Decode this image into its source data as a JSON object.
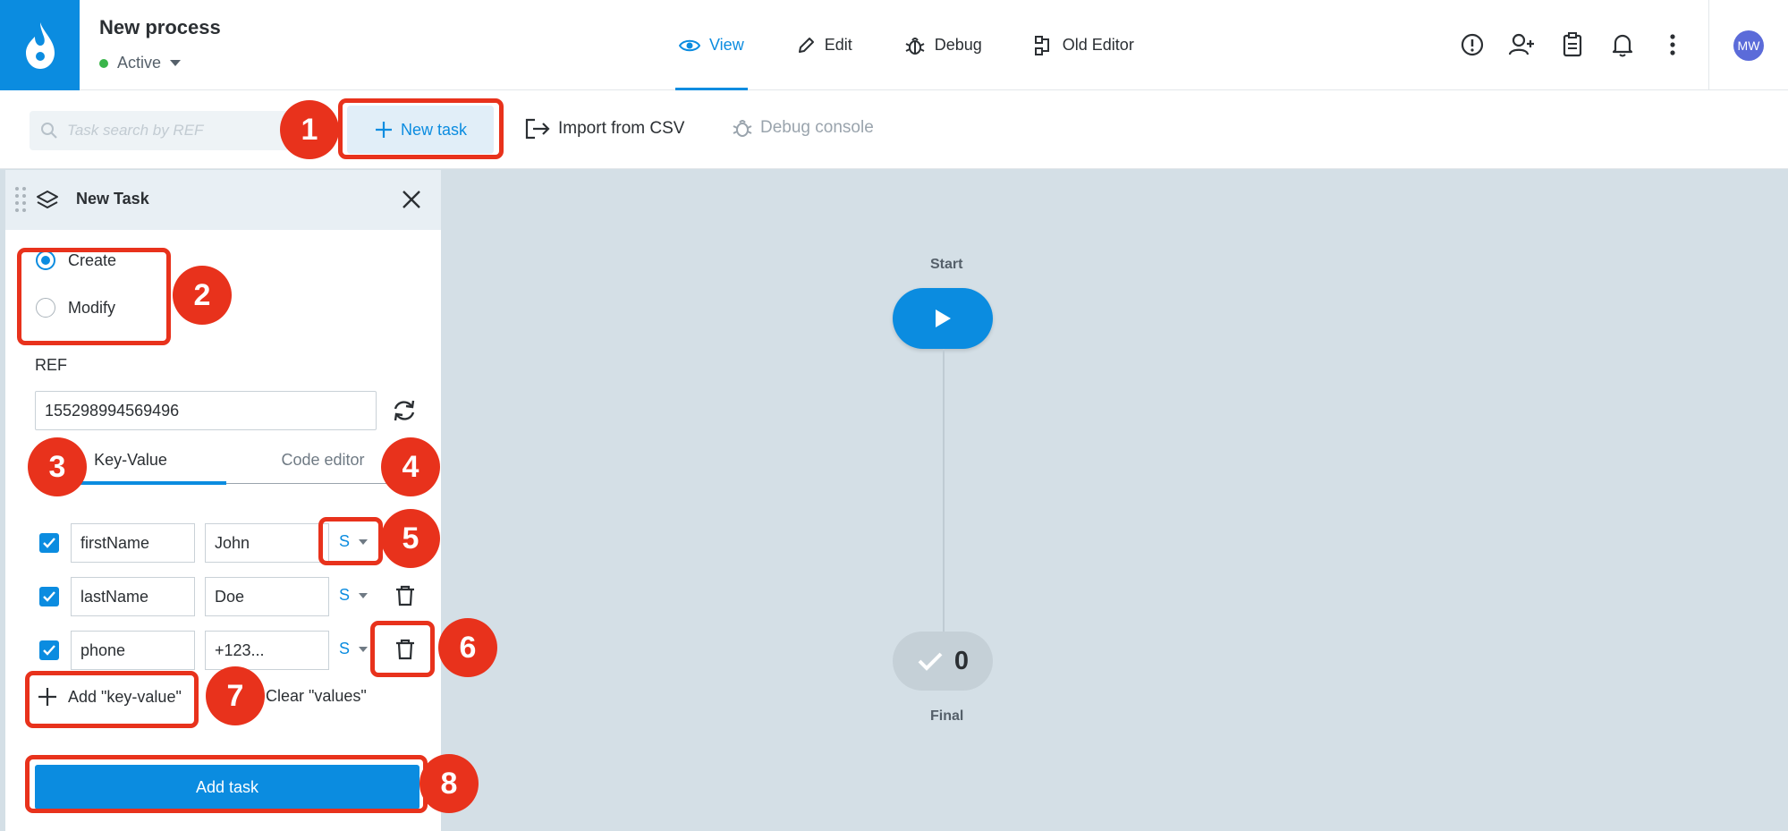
{
  "header": {
    "process_title": "New process",
    "status": "Active",
    "status_color": "#3ab54a",
    "modes": [
      {
        "label": "View",
        "icon": "eye-icon",
        "active": true
      },
      {
        "label": "Edit",
        "icon": "pencil-icon",
        "active": false
      },
      {
        "label": "Debug",
        "icon": "bug-icon",
        "active": false
      },
      {
        "label": "Old Editor",
        "icon": "flow-icon",
        "active": false
      }
    ],
    "right_icons": [
      "alert-icon",
      "add-user-icon",
      "clipboard-icon",
      "bell-icon",
      "more-vertical-icon"
    ],
    "avatar_initials": "MW",
    "accent_color": "#0b8ce0"
  },
  "toolbar": {
    "search_placeholder": "Task search by REF",
    "new_task_label": "New task",
    "import_label": "Import from CSV",
    "debug_console_label": "Debug console"
  },
  "panel": {
    "title": "New Task",
    "mode_options": [
      {
        "label": "Create",
        "selected": true
      },
      {
        "label": "Modify",
        "selected": false
      }
    ],
    "ref_label": "REF",
    "ref_value": "155298994569496",
    "tabs": [
      {
        "label": "Key-Value",
        "active": true
      },
      {
        "label": "Code editor",
        "active": false
      }
    ],
    "rows": [
      {
        "checked": true,
        "key": "firstName",
        "value": "John",
        "type": "S"
      },
      {
        "checked": true,
        "key": "lastName",
        "value": "Doe",
        "type": "S"
      },
      {
        "checked": true,
        "key": "phone",
        "value": "+123...",
        "type": "S"
      }
    ],
    "add_kv_label": "Add \"key-value\"",
    "clear_values_label": "Clear \"values\"",
    "add_task_label": "Add task"
  },
  "canvas": {
    "start_label": "Start",
    "final_label": "Final",
    "final_count": "0"
  },
  "annotations": [
    "1",
    "2",
    "3",
    "4",
    "5",
    "6",
    "7",
    "8"
  ],
  "annotation_color": "#e8321c"
}
